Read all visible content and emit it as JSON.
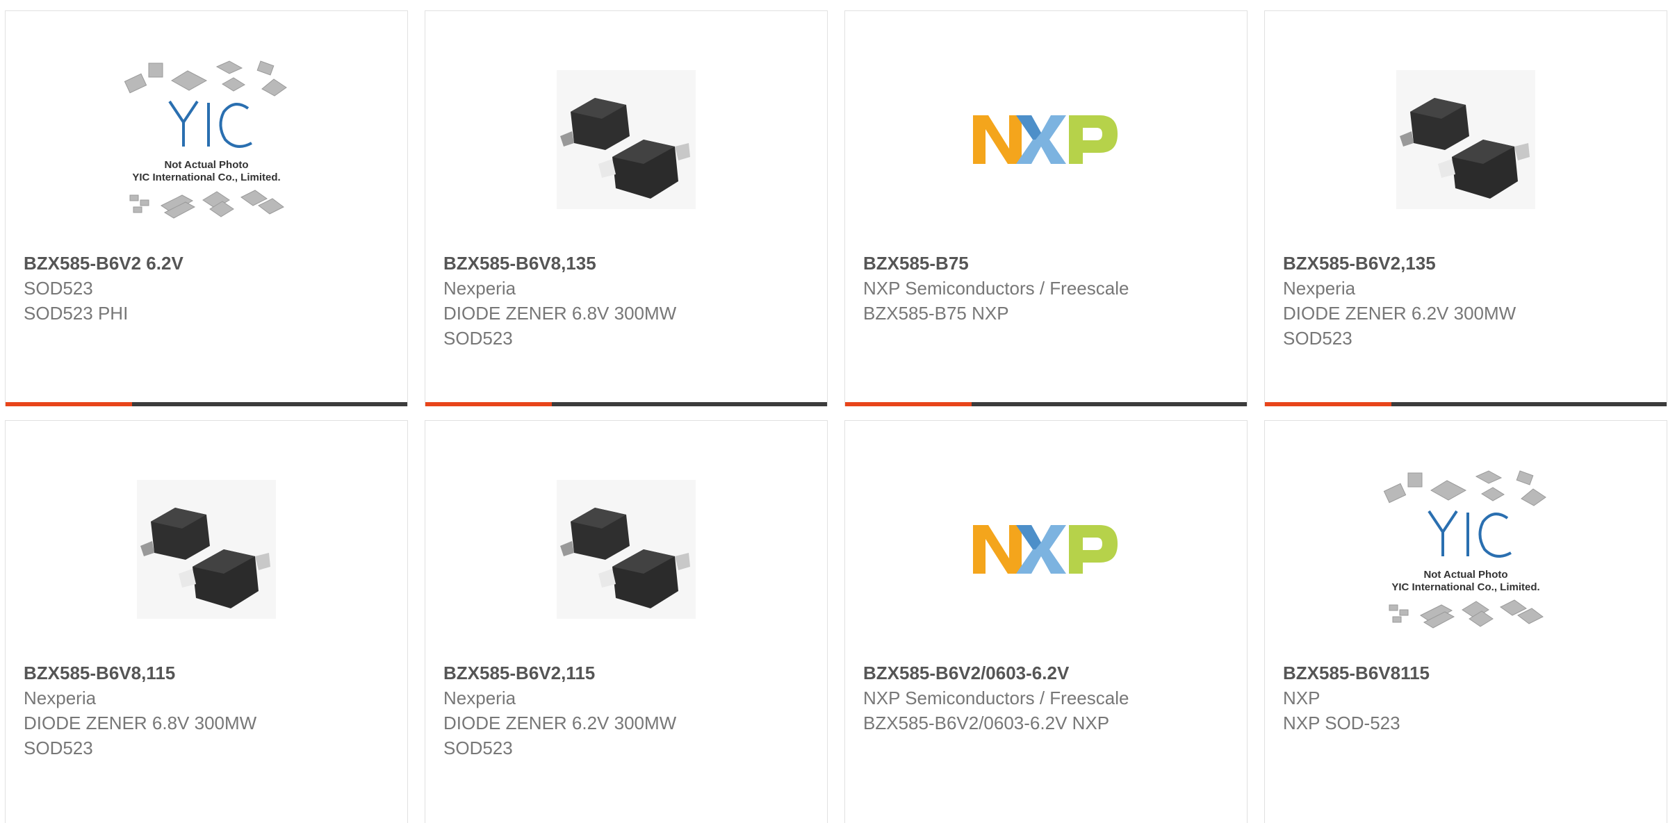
{
  "colors": {
    "accent": "#e8451a",
    "bar": "#3c3c3c"
  },
  "products": [
    {
      "image": "yic-placeholder-image",
      "part": "BZX585-B6V2 6.2V",
      "lines": [
        "SOD523",
        "SOD523 PHI"
      ]
    },
    {
      "image": "sod523-package-image",
      "part": "BZX585-B6V8,135",
      "lines": [
        "Nexperia",
        "DIODE ZENER 6.8V 300MW",
        "SOD523"
      ]
    },
    {
      "image": "nxp-logo-image",
      "part": "BZX585-B75",
      "lines": [
        "NXP Semiconductors / Freescale",
        "BZX585-B75 NXP"
      ]
    },
    {
      "image": "sod523-package-image",
      "part": "BZX585-B6V2,135",
      "lines": [
        "Nexperia",
        "DIODE ZENER 6.2V 300MW",
        "SOD523"
      ]
    },
    {
      "image": "sod523-package-image",
      "part": "BZX585-B6V8,115",
      "lines": [
        "Nexperia",
        "DIODE ZENER 6.8V 300MW",
        "SOD523"
      ]
    },
    {
      "image": "sod523-package-image",
      "part": "BZX585-B6V2,115",
      "lines": [
        "Nexperia",
        "DIODE ZENER 6.2V 300MW",
        "SOD523"
      ]
    },
    {
      "image": "nxp-logo-image",
      "part": "BZX585-B6V2/0603-6.2V",
      "lines": [
        "NXP Semiconductors / Freescale",
        "BZX585-B6V2/0603-6.2V NXP"
      ]
    },
    {
      "image": "yic-placeholder-image",
      "part": "BZX585-B6V8115",
      "lines": [
        "NXP",
        "NXP SOD-523"
      ]
    }
  ],
  "yic": {
    "logo": "YIC",
    "caption1": "Not Actual Photo",
    "caption2": "YIC International Co., Limited."
  },
  "nxp": {
    "logo": "NXP"
  }
}
